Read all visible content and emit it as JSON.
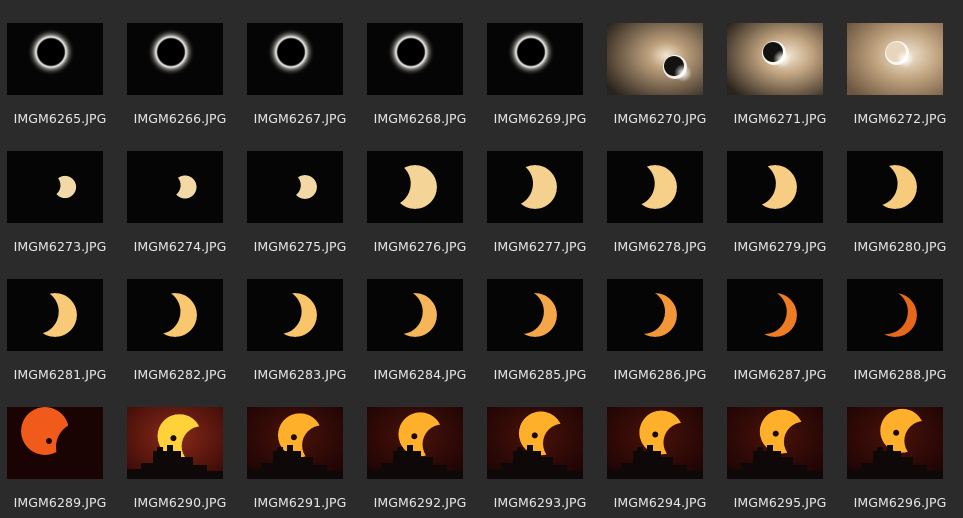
{
  "files": [
    {
      "name": "IMGM6265.JPG",
      "thumbnail": "totality-ring"
    },
    {
      "name": "IMGM6266.JPG",
      "thumbnail": "totality-ring"
    },
    {
      "name": "IMGM6267.JPG",
      "thumbnail": "totality-ring"
    },
    {
      "name": "IMGM6268.JPG",
      "thumbnail": "totality-ring"
    },
    {
      "name": "IMGM6269.JPG",
      "thumbnail": "totality-ring"
    },
    {
      "name": "IMGM6270.JPG",
      "thumbnail": "diamond-ring-dim"
    },
    {
      "name": "IMGM6271.JPG",
      "thumbnail": "diamond-ring-bright"
    },
    {
      "name": "IMGM6272.JPG",
      "thumbnail": "diamond-ring-brightest"
    },
    {
      "name": "IMGM6273.JPG",
      "thumbnail": "thin-crescent",
      "phase": 0.06
    },
    {
      "name": "IMGM6274.JPG",
      "thumbnail": "thin-crescent",
      "phase": 0.08
    },
    {
      "name": "IMGM6275.JPG",
      "thumbnail": "thin-crescent",
      "phase": 0.1
    },
    {
      "name": "IMGM6276.JPG",
      "thumbnail": "crescent",
      "phase": 0.22
    },
    {
      "name": "IMGM6277.JPG",
      "thumbnail": "crescent",
      "phase": 0.3
    },
    {
      "name": "IMGM6278.JPG",
      "thumbnail": "crescent",
      "phase": 0.36
    },
    {
      "name": "IMGM6279.JPG",
      "thumbnail": "crescent",
      "phase": 0.4
    },
    {
      "name": "IMGM6280.JPG",
      "thumbnail": "crescent",
      "phase": 0.46
    },
    {
      "name": "IMGM6281.JPG",
      "thumbnail": "crescent",
      "phase": 0.5
    },
    {
      "name": "IMGM6282.JPG",
      "thumbnail": "crescent",
      "phase": 0.56
    },
    {
      "name": "IMGM6283.JPG",
      "thumbnail": "crescent",
      "phase": 0.6
    },
    {
      "name": "IMGM6284.JPG",
      "thumbnail": "crescent",
      "phase": 0.64
    },
    {
      "name": "IMGM6285.JPG",
      "thumbnail": "crescent",
      "phase": 0.68
    },
    {
      "name": "IMGM6286.JPG",
      "thumbnail": "crescent",
      "phase": 0.72
    },
    {
      "name": "IMGM6287.JPG",
      "thumbnail": "crescent",
      "phase": 0.78
    },
    {
      "name": "IMGM6288.JPG",
      "thumbnail": "crescent",
      "phase": 0.82
    },
    {
      "name": "IMGM6289.JPG",
      "thumbnail": "sunset-partial-clipped"
    },
    {
      "name": "IMGM6290.JPG",
      "thumbnail": "sunset-partial-skyline-bright"
    },
    {
      "name": "IMGM6291.JPG",
      "thumbnail": "sunset-partial-skyline"
    },
    {
      "name": "IMGM6292.JPG",
      "thumbnail": "sunset-partial-skyline"
    },
    {
      "name": "IMGM6293.JPG",
      "thumbnail": "sunset-partial-skyline"
    },
    {
      "name": "IMGM6294.JPG",
      "thumbnail": "sunset-partial-skyline"
    },
    {
      "name": "IMGM6295.JPG",
      "thumbnail": "sunset-partial-skyline"
    },
    {
      "name": "IMGM6296.JPG",
      "thumbnail": "sunset-partial-skyline"
    }
  ],
  "colors": {
    "background": "#2b2b2b",
    "label_text": "#e6e6e6",
    "photo_black": "#050505",
    "sun_pale": "#f1dcae",
    "sun_yellow": "#f9c56a",
    "sun_orange": "#f28a2b",
    "sun_red": "#e35a12",
    "sunset_sky": "#3a0a07"
  }
}
